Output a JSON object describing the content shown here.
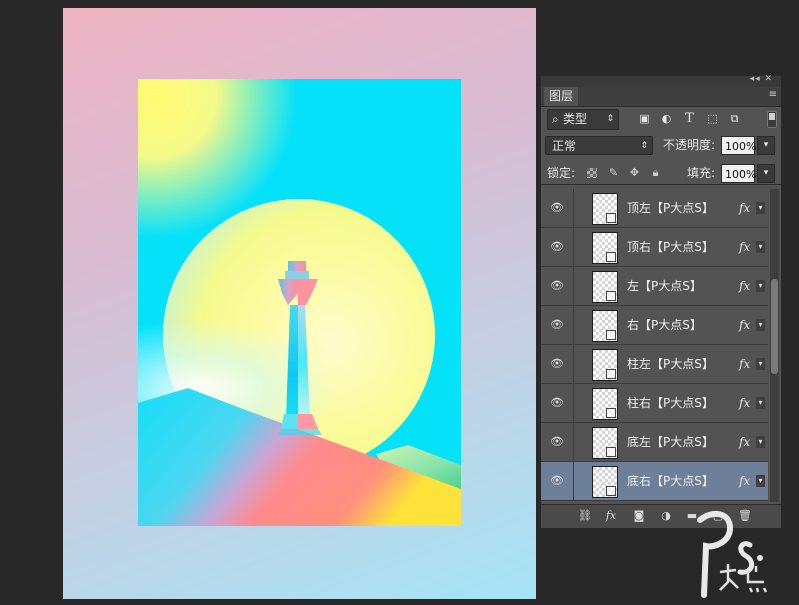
{
  "panel": {
    "tab_label": "图层",
    "collapse_arrows": "◂◂ ✕",
    "menu_icon": "≡",
    "filter": {
      "label": "类型",
      "icons": [
        "image-filter-icon",
        "adjustment-filter-icon",
        "type-filter-icon",
        "shape-filter-icon",
        "smart-object-filter-icon"
      ]
    },
    "blend_mode": "正常",
    "opacity_label": "不透明度:",
    "opacity_value": "100%",
    "lock_label": "锁定:",
    "fill_label": "填充:",
    "fill_value": "100%",
    "layers": [
      {
        "name": "顶左【P大点S】",
        "fx": "fx",
        "selected": false
      },
      {
        "name": "顶右【P大点S】",
        "fx": "fx",
        "selected": false
      },
      {
        "name": "左【P大点S】",
        "fx": "fx",
        "selected": false
      },
      {
        "name": "右【P大点S】",
        "fx": "fx",
        "selected": false
      },
      {
        "name": "柱左【P大点S】",
        "fx": "fx",
        "selected": false
      },
      {
        "name": "柱右【P大点S】",
        "fx": "fx",
        "selected": false
      },
      {
        "name": "底左【P大点S】",
        "fx": "fx",
        "selected": false
      },
      {
        "name": "底右【P大点S】",
        "fx": "fx",
        "selected": true
      }
    ],
    "footer_icons": [
      "link-icon",
      "fx-icon",
      "mask-icon",
      "adjustment-icon",
      "folder-icon",
      "new-layer-icon",
      "trash-icon"
    ]
  },
  "colors": {
    "app_bg": "#282828",
    "panel_bg": "#535353",
    "selected_layer": "#6e7f99",
    "art_cyan": "#06e1fa",
    "art_yellow": "#fbfb9c",
    "art_pink": "#ff8a8a"
  },
  "watermark": {
    "text": "PS 大点"
  }
}
